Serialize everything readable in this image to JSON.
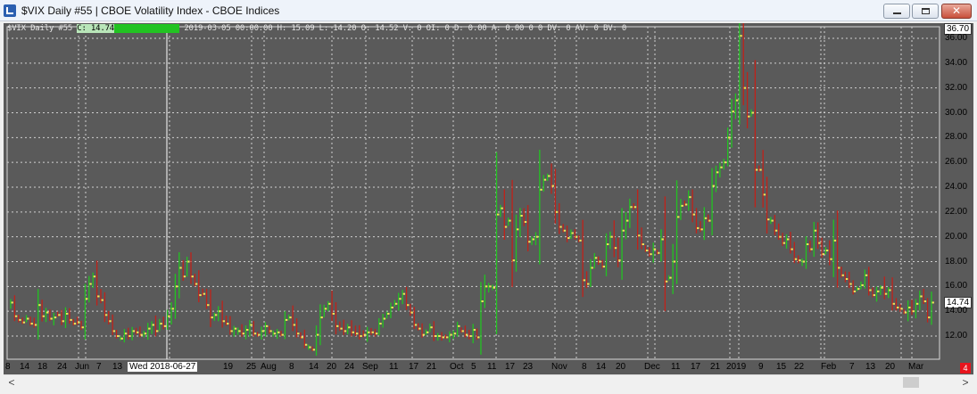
{
  "window": {
    "title": "$VIX  Daily  #55 | CBOE Volatility Index - CBOE Indices"
  },
  "info_line": {
    "prefix": "$VIX Daily #55",
    "close": "C: 14.74",
    "green_block": "00000000000000",
    "rest": "2019-03-05 00:00:00 H: 15.09 L: 14.20 O: 14.52 V: 0 OI: 0 D: 0.00 A: 0.00 0 0 DV: 0 AV: 0 BV: 0"
  },
  "price_scale": {
    "top_tag": "36.70",
    "last_tag": "14.74",
    "labels": [
      "36.00",
      "34.00",
      "32.00",
      "30.00",
      "28.00",
      "26.00",
      "24.00",
      "22.00",
      "20.00",
      "18.00",
      "16.00",
      "14.00",
      "12.00"
    ]
  },
  "time_scale": {
    "crosshair_label": "Wed 2018-06-27",
    "labels": [
      "8",
      "14",
      "18",
      "24",
      "Jun",
      "7",
      "13",
      "13",
      "19",
      "25",
      "Aug",
      "8",
      "14",
      "20",
      "24",
      "Sep",
      "11",
      "17",
      "21",
      "Oct",
      "5",
      "11",
      "17",
      "23",
      "Nov",
      "8",
      "14",
      "20",
      "Dec",
      "11",
      "17",
      "21",
      "2019",
      "9",
      "15",
      "22",
      "Feb",
      "7",
      "13",
      "20",
      "Mar"
    ]
  },
  "badge": "4",
  "colors": {
    "background": "#5a5a5a",
    "up": "#22c322",
    "down": "#c0221a",
    "close_tick": "#f0e65a"
  },
  "chart_data": {
    "type": "candlestick-bars",
    "title": "$VIX  Daily  #55 | CBOE Volatility Index - CBOE Indices",
    "ylim": [
      11.0,
      36.9
    ],
    "close_series": [
      14.7,
      13.6,
      13.3,
      13.1,
      13.4,
      13.0,
      12.9,
      14.5,
      13.6,
      13.9,
      13.4,
      13.5,
      13.7,
      13.2,
      13.8,
      13.3,
      13.0,
      13.1,
      12.7,
      15.0,
      16.2,
      16.8,
      15.2,
      14.9,
      13.7,
      13.2,
      12.4,
      12.0,
      11.8,
      12.2,
      12.0,
      12.4,
      12.3,
      12.1,
      12.2,
      12.6,
      12.9,
      12.4,
      13.0,
      12.8,
      13.6,
      14.2,
      16.0,
      17.5,
      16.8,
      18.0,
      16.8,
      16.2,
      15.3,
      15.4,
      14.5,
      13.5,
      13.7,
      14.0,
      13.2,
      13.0,
      12.4,
      12.6,
      12.4,
      12.2,
      12.5,
      12.9,
      12.2,
      12.1,
      12.4,
      12.8,
      12.4,
      12.2,
      12.3,
      12.1,
      13.3,
      13.5,
      12.9,
      12.2,
      11.9,
      11.3,
      11.1,
      10.9,
      12.1,
      13.5,
      14.2,
      14.6,
      13.8,
      12.8,
      12.6,
      12.4,
      12.7,
      12.3,
      12.2,
      12.0,
      12.1,
      12.3,
      12.3,
      12.2,
      13.0,
      13.4,
      13.8,
      14.3,
      14.6,
      15.0,
      15.4,
      14.5,
      13.9,
      12.9,
      12.6,
      12.1,
      12.3,
      12.7,
      12.0,
      12.0,
      11.9,
      11.9,
      12.1,
      12.2,
      12.8,
      12.4,
      12.1,
      12.0,
      12.5,
      11.9,
      14.8,
      16.0,
      16.0,
      15.9,
      21.8,
      22.3,
      20.8,
      21.3,
      18.1,
      20.6,
      21.7,
      21.2,
      19.6,
      19.8,
      20.0,
      23.8,
      24.6,
      24.9,
      24.1,
      22.0,
      20.8,
      20.5,
      19.9,
      20.3,
      20.0,
      19.7,
      16.5,
      16.2,
      17.5,
      18.3,
      18.0,
      17.6,
      19.4,
      20.0,
      19.1,
      18.1,
      20.5,
      21.3,
      22.4,
      22.4,
      20.1,
      19.4,
      18.9,
      18.6,
      19.0,
      18.7,
      19.8,
      16.4,
      16.7,
      18.0,
      21.6,
      22.5,
      22.6,
      23.2,
      21.8,
      20.7,
      20.6,
      21.5,
      21.3,
      24.1,
      25.2,
      25.6,
      26.0,
      28.0,
      30.1,
      31.0,
      36.2,
      32.0,
      29.7,
      30.0,
      25.4,
      25.4,
      23.4,
      21.4,
      21.3,
      20.5,
      20.0,
      19.5,
      19.8,
      19.0,
      18.2,
      18.1,
      18.0,
      19.4,
      19.0,
      20.5,
      19.5,
      18.6,
      18.9,
      18.2,
      19.7,
      17.5,
      16.9,
      16.6,
      16.2,
      15.6,
      15.8,
      16.1,
      16.9,
      15.7,
      15.3,
      15.6,
      15.9,
      15.4,
      15.7,
      14.6,
      14.3,
      14.2,
      13.9,
      14.3,
      14.0,
      14.6,
      15.2,
      14.8,
      13.5,
      14.7
    ]
  }
}
